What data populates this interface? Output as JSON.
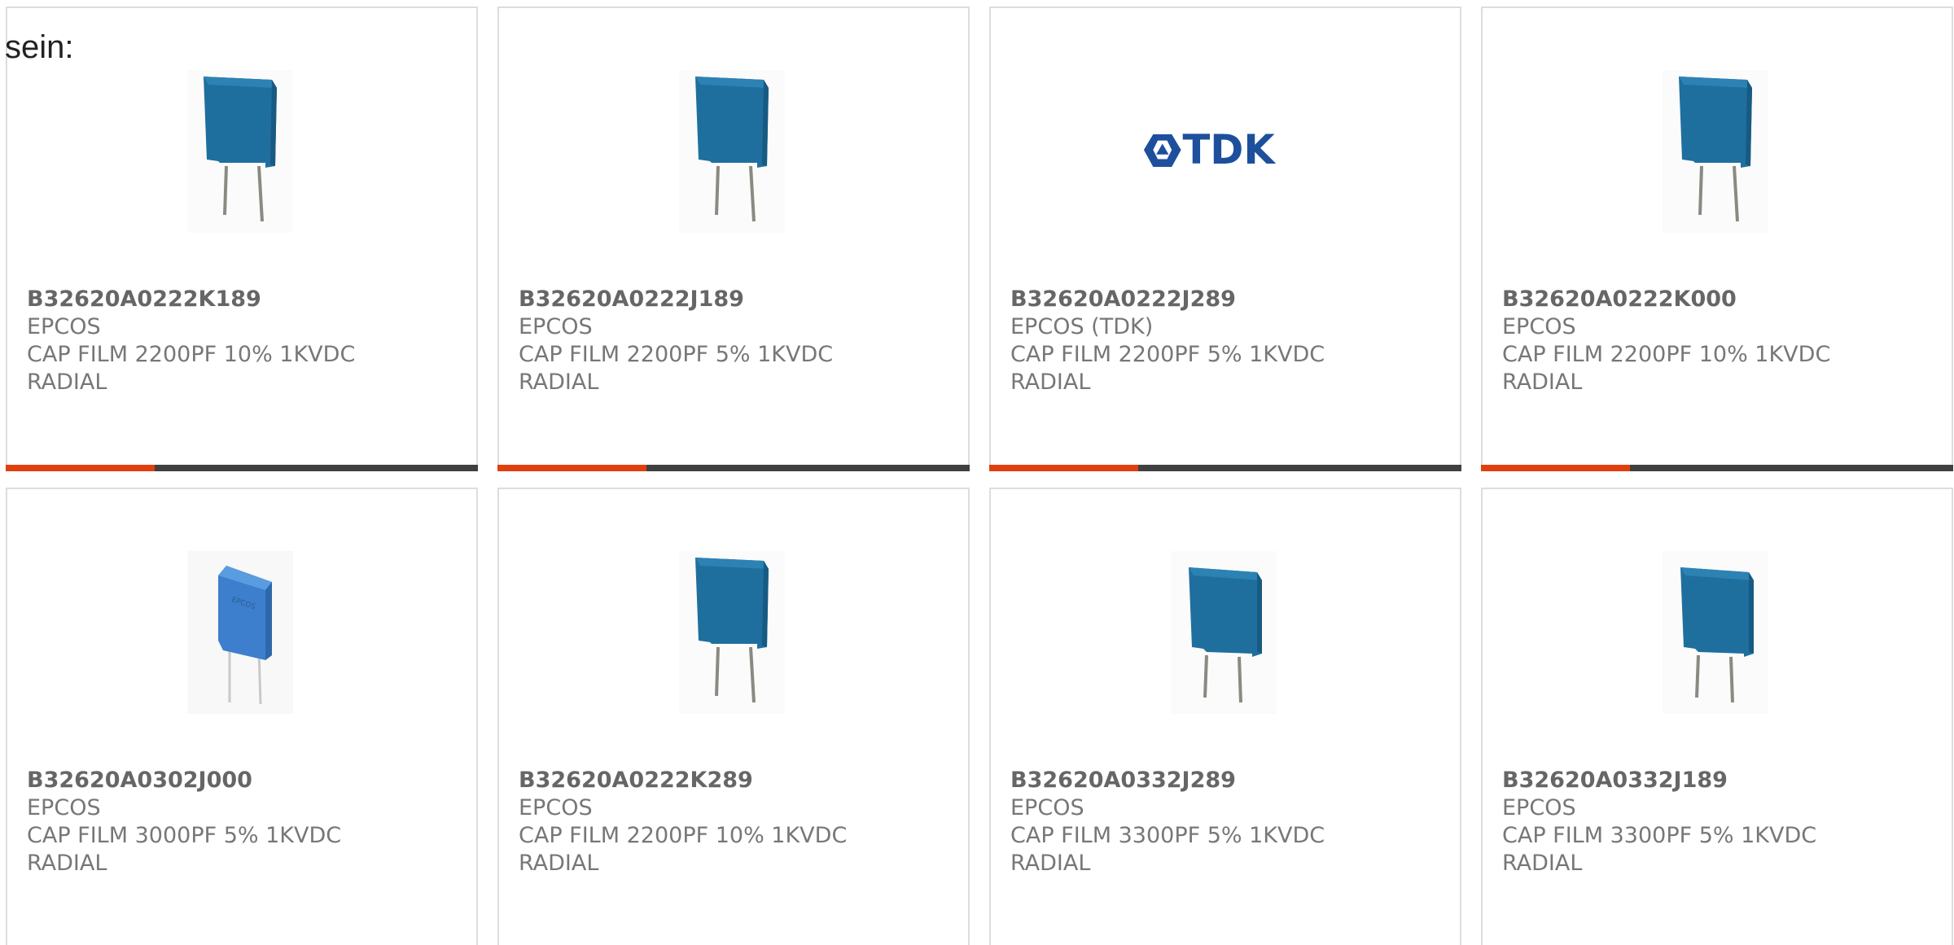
{
  "intro_text": "sein:",
  "colors": {
    "accent": "#e0400e",
    "bar_dark": "#404040",
    "text": "#777777",
    "capacitor_blue": "#1f6f9e",
    "tdk_logo": "#1d4f9c"
  },
  "products": [
    {
      "part_number": "B32620A0222K189",
      "manufacturer": "EPCOS",
      "description": "CAP FILM 2200PF 10% 1KVDC\nRADIAL",
      "image": "capacitor-dark-blue"
    },
    {
      "part_number": "B32620A0222J189",
      "manufacturer": "EPCOS",
      "description": "CAP FILM 2200PF 5% 1KVDC\nRADIAL",
      "image": "capacitor-dark-blue"
    },
    {
      "part_number": "B32620A0222J289",
      "manufacturer": "EPCOS (TDK)",
      "description": "CAP FILM 2200PF 5% 1KVDC\nRADIAL",
      "image": "tdk-logo",
      "logo_text": "TDK"
    },
    {
      "part_number": "B32620A0222K000",
      "manufacturer": "EPCOS",
      "description": "CAP FILM 2200PF 10% 1KVDC\nRADIAL",
      "image": "capacitor-dark-blue"
    },
    {
      "part_number": "B32620A0302J000",
      "manufacturer": "EPCOS",
      "description": "CAP FILM 3000PF 5% 1KVDC\nRADIAL",
      "image": "capacitor-light-blue"
    },
    {
      "part_number": "B32620A0222K289",
      "manufacturer": "EPCOS",
      "description": "CAP FILM 2200PF 10% 1KVDC\nRADIAL",
      "image": "capacitor-dark-blue"
    },
    {
      "part_number": "B32620A0332J289",
      "manufacturer": "EPCOS",
      "description": "CAP FILM 3300PF 5% 1KVDC\nRADIAL",
      "image": "capacitor-square-blue"
    },
    {
      "part_number": "B32620A0332J189",
      "manufacturer": "EPCOS",
      "description": "CAP FILM 3300PF 5% 1KVDC\nRADIAL",
      "image": "capacitor-square-blue"
    }
  ]
}
